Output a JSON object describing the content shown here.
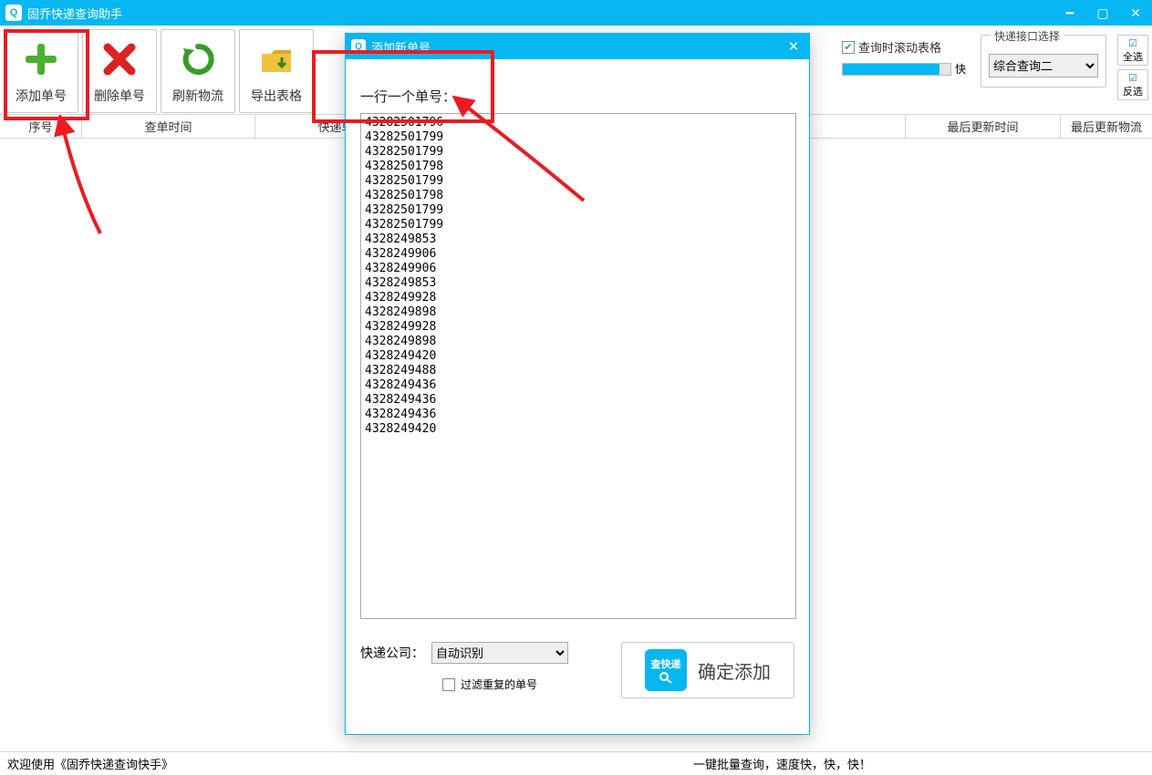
{
  "titlebar": {
    "title": "固乔快递查询助手"
  },
  "toolbar": {
    "add": "添加单号",
    "delete": "删除单号",
    "refresh": "刷新物流",
    "export": "导出表格",
    "scroll_checkbox": "查询时滚动表格",
    "speed_label": "快",
    "interface_group_title": "快递接口选择",
    "interface_selected": "综合查询二",
    "select_all": "全选",
    "invert_selection": "反选"
  },
  "columns": {
    "seq": "序号",
    "query_time": "查单时间",
    "tracking_no": "快递单号",
    "last_update": "最后更新时间",
    "last_logistics": "最后更新物流"
  },
  "dialog": {
    "title": "添加新单号",
    "instruction": "一行一个单号：",
    "tracking_numbers": "43282501796\n43282501799\n43282501799\n43282501798\n43282501799\n43282501798\n43282501799\n43282501799\n4328249853\n4328249906\n4328249906\n4328249853\n4328249928\n4328249898\n4328249928\n4328249898\n4328249420\n4328249488\n4328249436\n4328249436\n4328249436\n4328249420",
    "company_label": "快递公司：",
    "company_selected": "自动识别",
    "filter_checkbox": "过滤重复的单号",
    "confirm_icon_text": "查快递",
    "confirm_label": "确定添加"
  },
  "statusbar": {
    "left": "欢迎使用《固乔快递查询快手》",
    "right": "一键批量查询，速度快，快，快！"
  }
}
